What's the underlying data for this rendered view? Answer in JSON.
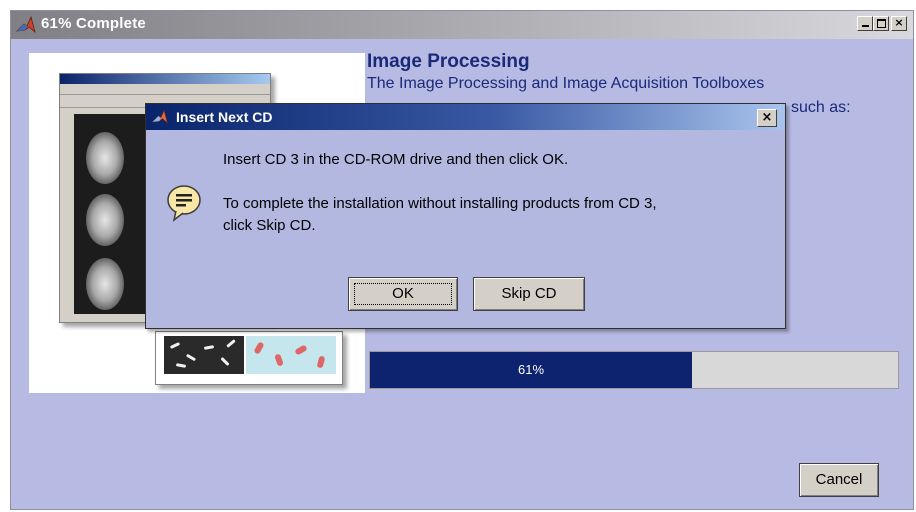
{
  "outer_window": {
    "title": "61% Complete",
    "icon": "matlab-logo-icon",
    "controls": {
      "minimize": "minimize-icon",
      "maximize": "maximize-icon",
      "close": "×"
    }
  },
  "product_info": {
    "title": "Image Processing",
    "line1": "The Image Processing and Image Acquisition Toolboxes",
    "line2": "such as:"
  },
  "progress": {
    "value": 61,
    "label": "61%"
  },
  "cancel_label": "Cancel",
  "dialog": {
    "title": "Insert Next CD",
    "icon": "matlab-logo-icon",
    "close": "×",
    "info_icon": "speech-bubble-info-icon",
    "message1": "Insert CD 3 in the CD-ROM drive and then click OK.",
    "message2": "To complete the installation without installing products from CD 3,",
    "message3": "click Skip CD.",
    "ok_label": "OK",
    "skip_label": "Skip CD"
  },
  "colors": {
    "window_bg": "#b7bae3",
    "dialog_bg": "#b3b8e0",
    "progress_fill": "#0e2370",
    "progress_track": "#d8d8d8",
    "heading_text": "#1a2a78"
  }
}
